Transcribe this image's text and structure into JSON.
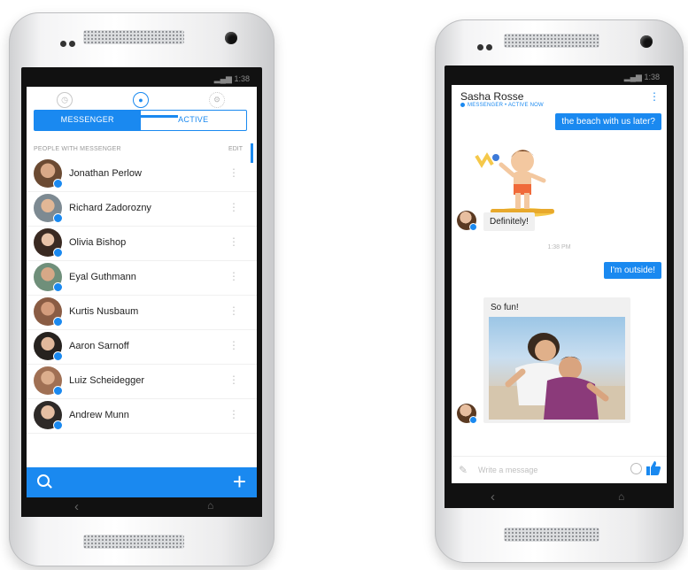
{
  "left_phone": {
    "status_time": "1:38",
    "segments": {
      "messenger": "MESSENGER",
      "active": "ACTIVE"
    },
    "section_header": "PEOPLE WITH MESSENGER",
    "edit_label": "EDIT",
    "contacts": [
      {
        "name": "Jonathan Perlow"
      },
      {
        "name": "Richard Zadorozny"
      },
      {
        "name": "Olivia Bishop"
      },
      {
        "name": "Eyal Guthmann"
      },
      {
        "name": "Kurtis Nusbaum"
      },
      {
        "name": "Aaron Sarnoff"
      },
      {
        "name": "Luiz Scheidegger"
      },
      {
        "name": "Andrew Munn"
      }
    ]
  },
  "right_phone": {
    "status_time": "1:38",
    "contact_name": "Sasha Rosse",
    "contact_status": "MESSENGER • ACTIVE NOW",
    "messages": {
      "out_1": "the beach with us later?",
      "in_1": "Definitely!",
      "timestamp": "1:38 PM",
      "out_2": "I'm outside!",
      "photo_caption": "So fun!"
    },
    "composer_placeholder": "Write a message"
  },
  "colors": {
    "accent": "#1a89f0",
    "bezel": "#111111"
  }
}
